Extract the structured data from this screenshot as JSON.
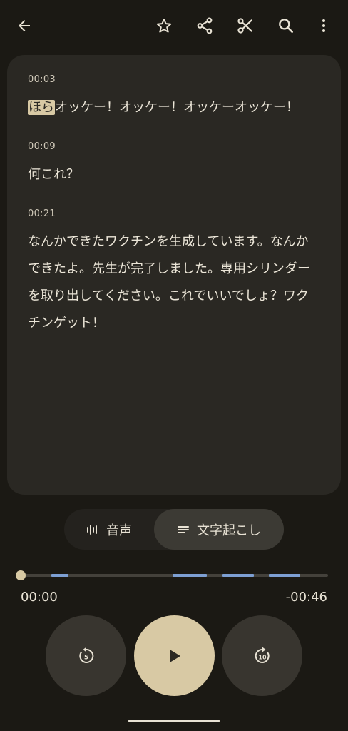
{
  "topbar": {
    "icons": [
      "back-arrow-icon",
      "star-icon",
      "share-icon",
      "scissors-icon",
      "search-icon",
      "more-vert-icon"
    ]
  },
  "transcript": {
    "segments": [
      {
        "time": "00:03",
        "highlight": "ほら",
        "text": "オッケー！オッケー！オッケーオッケー！"
      },
      {
        "time": "00:09",
        "text": "何これ？"
      },
      {
        "time": "00:21",
        "text": "なんかできたワクチンを生成しています。なんかできたよ。先生が完了しました。専用シリンダーを取り出してください。これでいいでしょ？ワクチンゲット！"
      }
    ]
  },
  "toggle": {
    "audio_label": "音声",
    "transcript_label": "文字起こし",
    "selected": "transcript"
  },
  "timeline": {
    "progress": 0,
    "current_time": "00:00",
    "remaining_time": "-00:46"
  },
  "controls": {
    "rewind_label": "5",
    "forward_label": "10"
  },
  "colors": {
    "background": "#1b1914",
    "card": "#2a2823",
    "accent": "#d8c9a4",
    "marker": "#7d9fd3"
  }
}
